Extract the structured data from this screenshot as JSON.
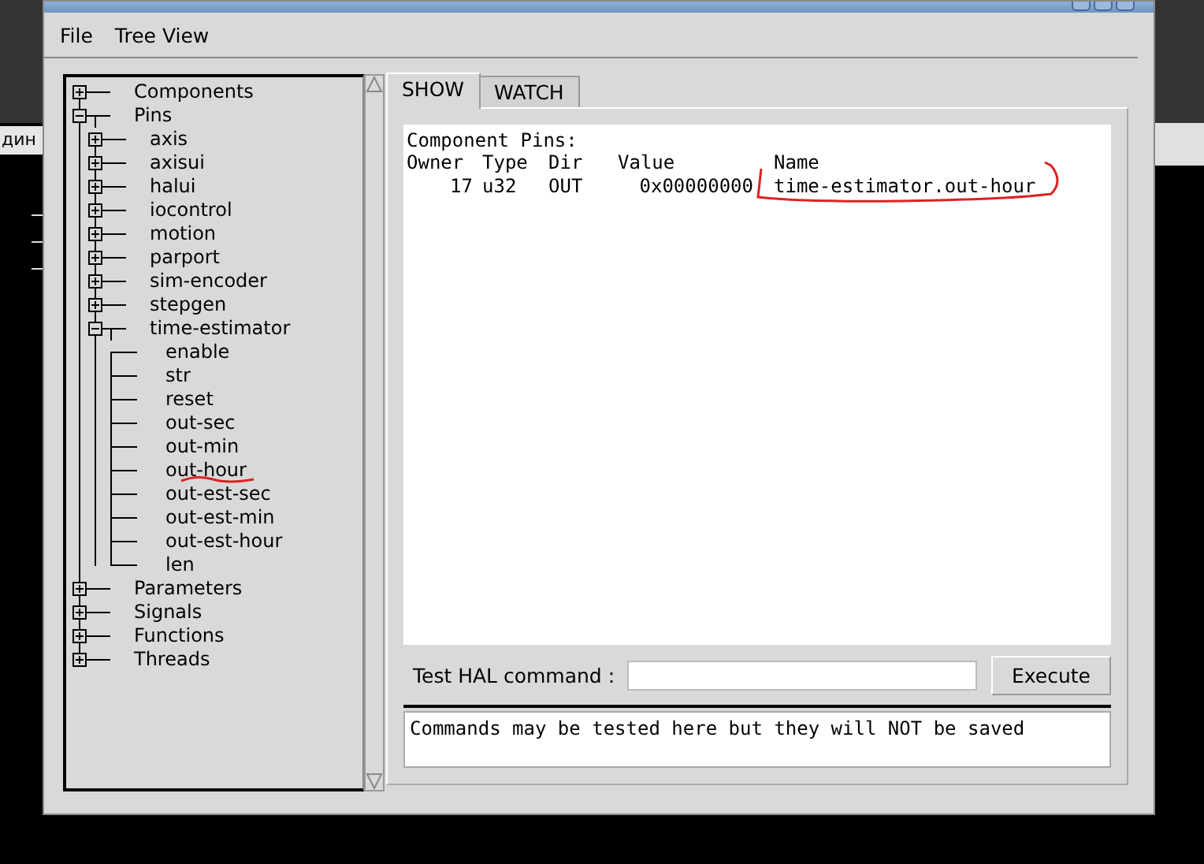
{
  "desktop": {
    "text": "дин"
  },
  "menu": [
    {
      "label": "File"
    },
    {
      "label": "Tree View"
    }
  ],
  "tree": [
    {
      "label": "Components",
      "expanded": false
    },
    {
      "label": "Pins",
      "expanded": true,
      "children": [
        {
          "label": "axis",
          "expanded": false
        },
        {
          "label": "axisui",
          "expanded": false
        },
        {
          "label": "halui",
          "expanded": false
        },
        {
          "label": "iocontrol",
          "expanded": false
        },
        {
          "label": "motion",
          "expanded": false
        },
        {
          "label": "parport",
          "expanded": false
        },
        {
          "label": "sim-encoder",
          "expanded": false
        },
        {
          "label": "stepgen",
          "expanded": false
        },
        {
          "label": "time-estimator",
          "expanded": true,
          "children": [
            {
              "label": "enable"
            },
            {
              "label": "str"
            },
            {
              "label": "reset"
            },
            {
              "label": "out-sec"
            },
            {
              "label": "out-min"
            },
            {
              "label": "out-hour"
            },
            {
              "label": "out-est-sec"
            },
            {
              "label": "out-est-min"
            },
            {
              "label": "out-est-hour"
            },
            {
              "label": "len"
            }
          ]
        }
      ]
    },
    {
      "label": "Parameters",
      "expanded": false
    },
    {
      "label": "Signals",
      "expanded": false
    },
    {
      "label": "Functions",
      "expanded": false
    },
    {
      "label": "Threads",
      "expanded": false
    }
  ],
  "tabs": [
    {
      "label": "SHOW",
      "selected": true
    },
    {
      "label": "WATCH",
      "selected": false
    }
  ],
  "pins_view": {
    "heading": "Component Pins:",
    "columns": [
      "Owner",
      "Type",
      "Dir",
      "Value",
      "Name"
    ],
    "rows": [
      [
        "17",
        "u32",
        "OUT",
        "0x00000000",
        "time-estimator.out-hour"
      ]
    ]
  },
  "command": {
    "label": "Test HAL command :",
    "button": "Execute"
  },
  "output": "Commands may be tested here but they will NOT be saved"
}
